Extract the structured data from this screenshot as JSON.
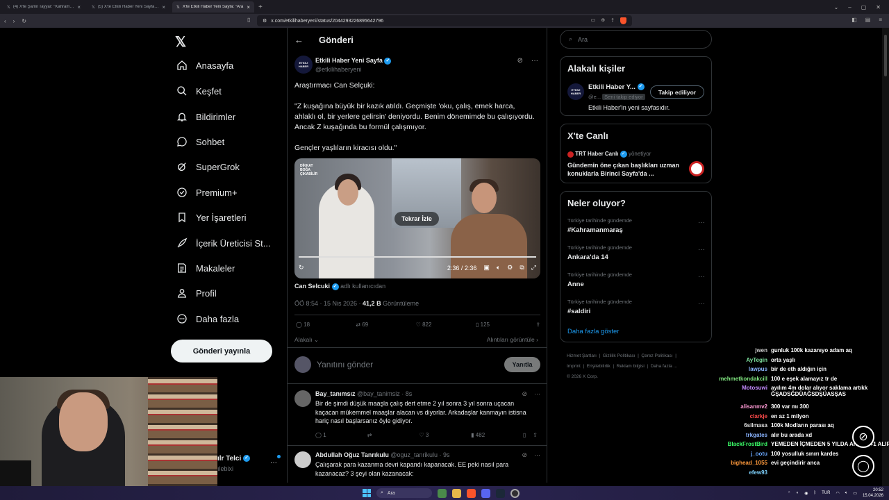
{
  "browser": {
    "tabs": [
      {
        "title": "(4) X'te Şamil Tayyar: \"Kahramanmaraş"
      },
      {
        "title": "(5) X'te Etkili Haber Yeni Sayfa: \"Neve"
      },
      {
        "title": "X'te Etkili Haber Yeni Sayfa: \"Ara",
        "active": true
      }
    ],
    "url": "x.com/etkilihaberyeni/status/2044293226895642796"
  },
  "nav": {
    "items": [
      {
        "label": "Anasayfa",
        "icon": "home-icon"
      },
      {
        "label": "Keşfet",
        "icon": "search-icon"
      },
      {
        "label": "Bildirimler",
        "icon": "bell-icon"
      },
      {
        "label": "Sohbet",
        "icon": "chat-icon"
      },
      {
        "label": "SuperGrok",
        "icon": "grok-icon"
      },
      {
        "label": "Premium+",
        "icon": "premium-icon"
      },
      {
        "label": "Yer İşaretleri",
        "icon": "bookmark-icon"
      },
      {
        "label": "İçerik Üreticisi St...",
        "icon": "rocket-icon"
      },
      {
        "label": "Makaleler",
        "icon": "article-icon"
      },
      {
        "label": "Profil",
        "icon": "profile-icon"
      },
      {
        "label": "Daha fazla",
        "icon": "more-icon"
      }
    ],
    "post_button": "Gönderi yayınla",
    "account": {
      "name": "ılr Telci",
      "handle": "ılebixi"
    }
  },
  "post": {
    "header_title": "Gönderi",
    "author_name": "Etkili Haber Yeni Sayfa",
    "author_handle": "@etkilihaberyeni",
    "avatar_text": "ETKİLİ HABER",
    "text": "Araştırmacı Can Selçuki:\n\n\"Z kuşağına büyük bir kazık atıldı. Geçmişte 'oku, çalış, emek harca, ahlaklı ol, bir yerlere gelirsin' deniyordu. Benim dönemimde bu çalışıyordu. Ancak Z kuşağında bu formül çalışmıyor.\n\nGençler yaşlıların kiracısı oldu.\"",
    "video": {
      "replay_label": "Tekrar İzle",
      "time": "2:36 / 2:36",
      "overlay_text": "DİKKAT BOĞA ÇIKABİLİR",
      "progress": 1.0
    },
    "source_name": "Can Selcuki",
    "source_suffix": "adlı kullanıcıdan",
    "meta_time": "ÖÖ 8:54 · 15 Nis 2026 · ",
    "meta_views": "41,2 B",
    "meta_views_label": " Görüntüleme",
    "stats": {
      "replies": "18",
      "reposts": "69",
      "likes": "822",
      "bookmarks": "125"
    },
    "related_label": "Alakalı",
    "quotes_label": "Alıntıları görüntüle",
    "reply_placeholder": "Yanıtını gönder",
    "reply_button": "Yanıtla"
  },
  "replies": [
    {
      "name": "Bay_tanımsız",
      "meta": "@bay_tanimsiz · 8s",
      "text": "Bir de şimdi düşük maaşla çalış dert etme 2 yıl sonra 3 yıl sonra uçacan kaçacan mükemmel  maaşlar alacan vs diyorlar. Arkadaşlar kanmayın istisna hariç nasıl başlarsanız öyle gidiyor.",
      "replies": "1",
      "reposts": "",
      "likes": "3",
      "views": "482"
    },
    {
      "name": "Abdullah Oğuz Tanrıkulu",
      "meta": "@oguz_tanrikulu · 9s",
      "text": "Çalışarak para kazanma devri kapandı kapanacak. EE peki nasıl para kazanacaz? 3 şeyi olan kazanacak:"
    }
  ],
  "sidebar": {
    "search_placeholder": "Ara",
    "related": {
      "title": "Alakalı kişiler",
      "name": "Etkili Haber Y...",
      "handle": "@e...",
      "follows_you": "Seni takip ediyor",
      "follow_button": "Takip ediliyor",
      "bio": "Etkili Haber'in yeni sayfasıdır."
    },
    "live": {
      "title": "X'te Canlı",
      "host": "TRT Haber Canlı",
      "host_role": "yönetiyor",
      "desc": "Gündemin öne çıkan başlıkları uzman konuklarla Birinci Sayfa'da ..."
    },
    "trends": {
      "title": "Neler oluyor?",
      "items": [
        {
          "context": "Türkiye tarihinde gündemde",
          "topic": "#Kahramanmaraş"
        },
        {
          "context": "Türkiye tarihinde gündemde",
          "topic": "Ankara'da 14"
        },
        {
          "context": "Türkiye tarihinde gündemde",
          "topic": "Anne"
        },
        {
          "context": "Türkiye tarihinde gündemde",
          "topic": "#saldiri"
        }
      ],
      "more": "Daha fazla göster"
    },
    "footer": [
      "Hizmet Şartları",
      "Gizlilik Politikası",
      "Çerez Politikası",
      "Imprint",
      "Erişilebilirlik",
      "Reklam bilgisi",
      "Daha fazla ...",
      "© 2026 X Corp."
    ]
  },
  "chat": [
    {
      "user": "jwen",
      "color": "#cfcfcf",
      "msg": "gunluk 100k kazanıyo adam aq"
    },
    {
      "user": "AyTegin",
      "color": "#7fe3a0",
      "msg": "orta yaşlı"
    },
    {
      "user": "lawpus",
      "color": "#8ab4ff",
      "msg": "bir de eth aldığın için"
    },
    {
      "user": "mehmetkondakcill",
      "color": "#7fe37f",
      "msg": "100 e eşek alamayız tr de"
    },
    {
      "user": "Motosuwi",
      "color": "#c58cff",
      "msg": "ayılım 4m dolar alıyor saklama artıkk ĞŞADSĞDÜAĞSDŞÜASŞAS"
    },
    {
      "user": "alisanmv2",
      "color": "#ff9ad5",
      "msg": "300 var mı 300"
    },
    {
      "user": "clarkje",
      "color": "#ff4b4b",
      "msg": "en az 1 milyon"
    },
    {
      "user": "6silmasa",
      "color": "#e0e0e0",
      "msg": "100k Modların parası aq"
    },
    {
      "user": "trkgates",
      "color": "#8ab4ff",
      "msg": "alır bu arada xd"
    },
    {
      "user": "BlackFrostBird",
      "color": "#3cff6a",
      "msg": "YEMEDEN İÇMEDEN 5 YILDA ANCA 3+1 ALIR"
    },
    {
      "user": "j_ootu",
      "color": "#6aa8ff",
      "msg": "100 yosulluk sınırı kardes"
    },
    {
      "user": "bighead_1055",
      "color": "#ff9a3c",
      "msg": "evi geçindirir anca"
    },
    {
      "user": "efew93",
      "color": "#7fd3ff",
      "msg": ""
    }
  ],
  "taskbar": {
    "search": "Ara",
    "lang": "TUR",
    "time": "20:52",
    "date": "15.04.2026"
  }
}
